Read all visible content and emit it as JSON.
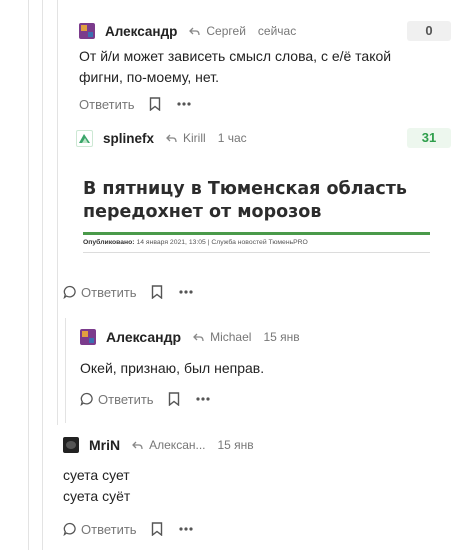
{
  "comments": [
    {
      "author": "Александр",
      "reply_to": "Сергей",
      "time": "сейчас",
      "score": "0",
      "text": "От й/и может зависеть смысл слова, с е/ё такой фигни, по-моему, нет.",
      "reply_label": "Ответить"
    },
    {
      "author": "splinefx",
      "reply_to": "Kirill",
      "time": "1 час",
      "score": "31",
      "news": {
        "title_line1": "В пятницу в Тюменская область",
        "title_line2": "передохнет от морозов",
        "meta_label": "Опубликовано:",
        "meta_value": "14 января 2021, 13:05 | Служба новостей ТюменьPRO"
      },
      "reply_label": "Ответить"
    },
    {
      "author": "Александр",
      "reply_to": "Michael",
      "time": "15 янв",
      "text": "Окей, признаю, был неправ.",
      "reply_label": "Ответить"
    },
    {
      "author": "MriN",
      "reply_to": "Алексан...",
      "time": "15 янв",
      "text_line1": "суета сует",
      "text_line2": "суета суёт",
      "reply_label": "Ответить"
    }
  ],
  "colors": {
    "score_zero_bg": "#f0f0f0",
    "score_positive_bg": "#edf7ee",
    "score_positive_text": "#2e9e4b",
    "thread_line": "#e3e3e3"
  },
  "icons": [
    "reply-arrow-icon",
    "comment-bubble-icon",
    "bookmark-icon",
    "more-dots-icon"
  ]
}
